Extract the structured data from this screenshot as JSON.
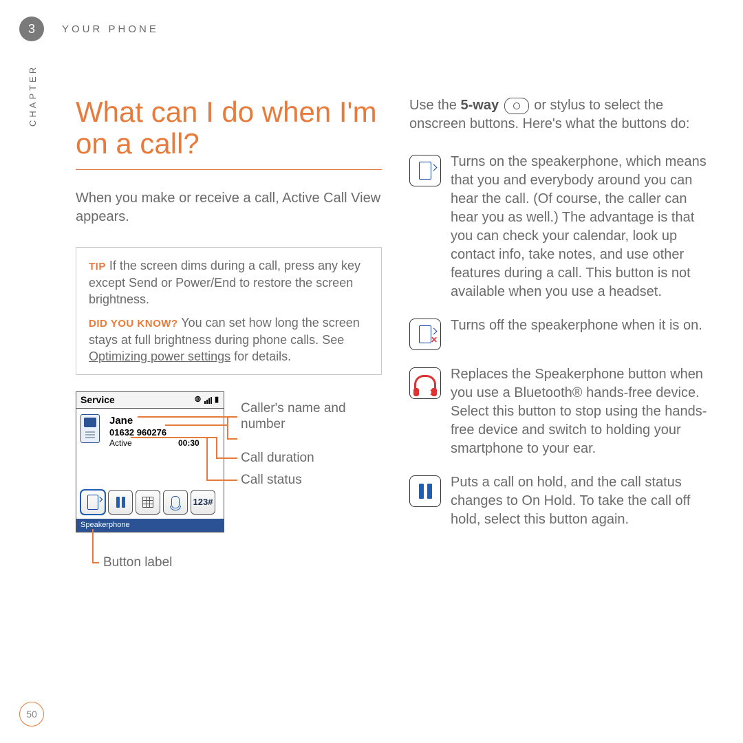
{
  "header": {
    "chapter_number": "3",
    "running_head": "YOUR PHONE",
    "chapter_rail": "CHAPTER",
    "page_number": "50"
  },
  "left": {
    "title": "What can I do when I'm on a call?",
    "intro": "When you make or receive a call, Active Call View appears.",
    "tip_label": "TIP",
    "tip_text": "If the screen dims during a call, press any key except Send or Power/End to restore the screen brightness.",
    "dyk_label": "DID YOU KNOW?",
    "dyk_text_before": "You can set how long the screen stays at full brightness during phone calls. See ",
    "dyk_link": "Optimizing power settings",
    "dyk_text_after": " for details.",
    "screenshot": {
      "service": "Service",
      "name": "Jane",
      "number": "01632 960276",
      "status": "Active",
      "time": "00:30",
      "btn_123": "123#",
      "footer": "Speakerphone"
    },
    "callouts": {
      "name": "Caller's name and number",
      "duration": "Call duration",
      "status": "Call status",
      "button": "Button label"
    }
  },
  "right": {
    "lead_before": "Use the ",
    "lead_bold": "5-way",
    "lead_after": " or stylus to select the onscreen buttons. Here's what the buttons do:",
    "rows": [
      "Turns on the speakerphone, which means that you and everybody around you can hear the call. (Of course, the caller can hear you as well.) The advantage is that you can check your calendar, look up contact info, take notes, and use other features during a call. This button is not available when you use a headset.",
      "Turns off the speakerphone when it is on.",
      "Replaces the Speakerphone button when you use a Bluetooth® hands-free device. Select this button to stop using the hands-free device and switch to holding your smartphone to your ear.",
      "Puts a call on hold, and the call status changes to On Hold. To take the call off hold, select this button again."
    ]
  }
}
